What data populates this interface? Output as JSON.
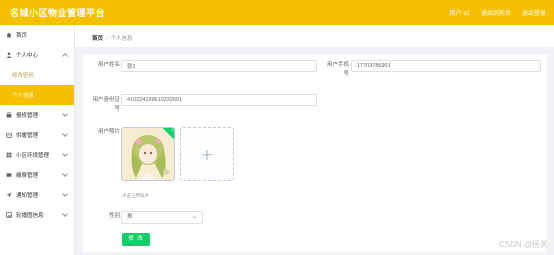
{
  "header": {
    "title": "名城小区物业管理平台",
    "user_label": "用户 a1",
    "home_link": "退出到前台",
    "logout_link": "退出登录"
  },
  "sidebar": {
    "items": [
      {
        "label": "首页",
        "icon": "home-icon"
      },
      {
        "label": "个人中心",
        "icon": "user-icon",
        "expanded": true
      },
      {
        "label": "报修管理",
        "icon": "tools-icon"
      },
      {
        "label": "供暖管理",
        "icon": "heat-icon"
      },
      {
        "label": "小区环境管理",
        "icon": "grid-icon"
      },
      {
        "label": "缴费管理",
        "icon": "wallet-icon"
      },
      {
        "label": "通知管理",
        "icon": "send-icon"
      },
      {
        "label": "轮播图信息",
        "icon": "image-icon"
      }
    ],
    "submenu": [
      {
        "label": "修改密码"
      },
      {
        "label": "个人信息",
        "active": true
      }
    ],
    "accent": "#f5c000"
  },
  "breadcrumb": {
    "home": "首页",
    "separator": "/",
    "current": "个人信息"
  },
  "form": {
    "name_label": "用户姓名",
    "name_value": "张1",
    "phone_label": "用户手机号",
    "phone_value": "17703786901",
    "id_label": "用户身份证号",
    "id_value": "410224199610232001",
    "photo_label": "用户照片",
    "upload_tip": "点击上传照片",
    "gender_label": "性别",
    "gender_value": "男",
    "submit_label": "修 改"
  },
  "watermark": "CSDN @杨芙"
}
